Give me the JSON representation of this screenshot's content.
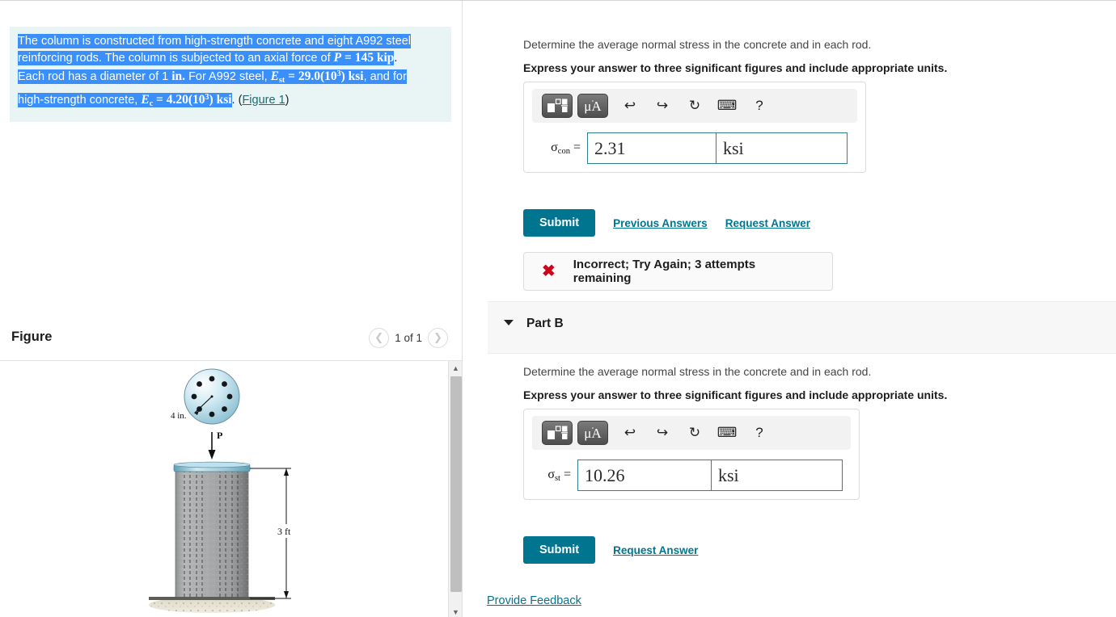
{
  "problem": {
    "line1": "The column is constructed from high-strength concrete and eight A992 steel",
    "line2_a": "reinforcing rods. The column is subjected to an axial force of ",
    "line2_P": "P",
    "line2_eq": " = ",
    "line2_val": "145 kip",
    "line2_end": ".",
    "line3_a": "Each rod has a diameter of 1 ",
    "line3_in": "in.",
    "line3_b": " For A992 steel, ",
    "line3_E": "E",
    "line3_Esub": "st",
    "line3_eq": " = ",
    "line3_val": "29.0(10",
    "line3_sup": "3",
    "line3_val2": ") ",
    "line3_unit": "ksi",
    "line3_end": ", and for",
    "line4_a": "high-strength concrete, ",
    "line4_E": "E",
    "line4_Esub": "c",
    "line4_eq": " = ",
    "line4_val": "4.20(10",
    "line4_sup": "3",
    "line4_val2": ") ",
    "line4_unit": "ksi",
    "line4_end": ". (",
    "figure_link": "Figure 1",
    "line4_close": ")"
  },
  "figure": {
    "title": "Figure",
    "pager_label": "1 of 1",
    "prev_icon": "chevron-left-icon",
    "next_icon": "chevron-right-icon",
    "diameter_label": "4 in.",
    "force_label": "P",
    "height_label": "3 ft"
  },
  "toolbar": {
    "template_icon": "math-template-icon",
    "units_label_mu": "μ",
    "units_label_ring": "˚",
    "units_label_A": "A",
    "undo_icon": "undo-icon",
    "redo_icon": "redo-icon",
    "reset_icon": "reset-icon",
    "keyboard_icon": "keyboard-icon",
    "help_icon": "help-icon",
    "help_label": "?"
  },
  "partA": {
    "question": "Determine the average normal stress in the concrete and in each rod.",
    "instruction": "Express your answer to three significant figures and include appropriate units.",
    "symbol_base": "σ",
    "symbol_sub": "con",
    "symbol_eq": " =",
    "answer_value": "2.31",
    "answer_units": "ksi",
    "submit_label": "Submit",
    "previous_answers_label": "Previous Answers",
    "request_answer_label": "Request Answer",
    "feedback_icon": "x-mark-icon",
    "feedback_text": "Incorrect; Try Again; 3 attempts remaining"
  },
  "partB": {
    "header_label": "Part B",
    "caret_icon": "caret-down-icon",
    "question": "Determine the average normal stress in the concrete and in each rod.",
    "instruction": "Express your answer to three significant figures and include appropriate units.",
    "symbol_base": "σ",
    "symbol_sub": "st",
    "symbol_eq": " =",
    "answer_value": "10.26",
    "answer_units": "ksi",
    "submit_label": "Submit",
    "request_answer_label": "Request Answer"
  },
  "footer": {
    "provide_feedback_label": "Provide Feedback"
  },
  "colors": {
    "accent_teal": "#00758f",
    "problem_bg": "#e9f5f4",
    "selection_blue": "#3a8ffb",
    "error_red": "#d0021b",
    "input_border": "#2d7f92",
    "band_grey": "#f7f7f7"
  }
}
